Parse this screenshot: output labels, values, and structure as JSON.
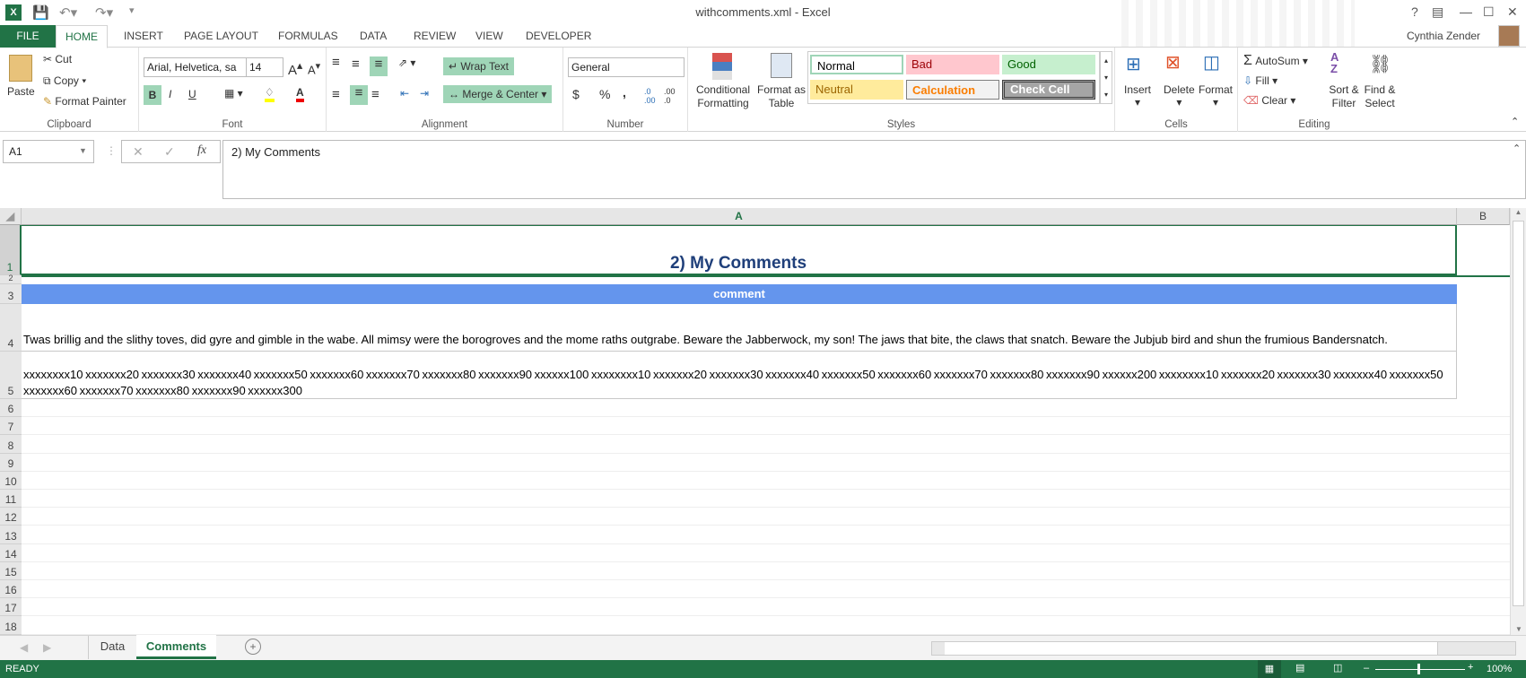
{
  "window": {
    "title": "withcomments.xml - Excel",
    "help": "?",
    "user": "Cynthia Zender"
  },
  "tabs": [
    "FILE",
    "HOME",
    "INSERT",
    "PAGE LAYOUT",
    "FORMULAS",
    "DATA",
    "REVIEW",
    "VIEW",
    "DEVELOPER"
  ],
  "clipboard": {
    "paste": "Paste",
    "cut": "Cut",
    "copy": "Copy",
    "format_painter": "Format Painter",
    "label": "Clipboard"
  },
  "font": {
    "name": "Arial, Helvetica, sa",
    "size": "14",
    "bold": "B",
    "italic": "I",
    "underline": "U",
    "label": "Font"
  },
  "alignment": {
    "wrap": "Wrap Text",
    "merge": "Merge & Center",
    "label": "Alignment"
  },
  "number": {
    "format": "General",
    "currency": "$",
    "percent": "%",
    "comma": ",",
    "label": "Number"
  },
  "styles": {
    "conditional": "Conditional Formatting",
    "format_table": "Format as Table",
    "normal": "Normal",
    "bad": "Bad",
    "good": "Good",
    "neutral": "Neutral",
    "calculation": "Calculation",
    "check": "Check Cell",
    "label": "Styles"
  },
  "cells": {
    "insert": "Insert",
    "delete": "Delete",
    "format": "Format",
    "label": "Cells"
  },
  "editing": {
    "autosum": "AutoSum",
    "fill": "Fill",
    "clear": "Clear",
    "sort": "Sort & Filter",
    "find": "Find & Select",
    "label": "Editing"
  },
  "formula_bar": {
    "name_box": "A1",
    "fx": "fx",
    "value": "2) My Comments"
  },
  "columns": [
    "A",
    "B"
  ],
  "rows": [
    "1",
    "2",
    "3",
    "4",
    "5",
    "6",
    "7",
    "8",
    "9",
    "10",
    "11",
    "12",
    "13",
    "14",
    "15",
    "16",
    "17",
    "18"
  ],
  "cells_data": {
    "a1": "2) My Comments",
    "a3": "comment",
    "a4": "Twas brillig and the slithy toves, did gyre and gimble in the wabe. All mimsy were the borogroves and the mome raths outgrabe. Beware the Jabberwock, my son! The jaws that bite, the claws that snatch. Beware the Jubjub bird and shun the frumious Bandersnatch.",
    "a5": "xxxxxxxx10 xxxxxxx20 xxxxxxx30 xxxxxxx40 xxxxxxx50 xxxxxxx60 xxxxxxx70 xxxxxxx80 xxxxxxx90 xxxxxx100 xxxxxxxx10 xxxxxxx20 xxxxxxx30 xxxxxxx40 xxxxxxx50 xxxxxxx60 xxxxxxx70 xxxxxxx80 xxxxxxx90 xxxxxx200 xxxxxxxx10 xxxxxxx20 xxxxxxx30 xxxxxxx40 xxxxxxx50 xxxxxxx60 xxxxxxx70 xxxxxxx80 xxxxxxx90 xxxxxx300"
  },
  "sheets": [
    {
      "name": "Data",
      "active": false
    },
    {
      "name": "Comments",
      "active": true
    }
  ],
  "status": {
    "ready": "READY",
    "zoom": "100%"
  },
  "colors": {
    "excel_green": "#217346",
    "header_blue": "#6495ed",
    "title_blue": "#1f3f7a"
  }
}
